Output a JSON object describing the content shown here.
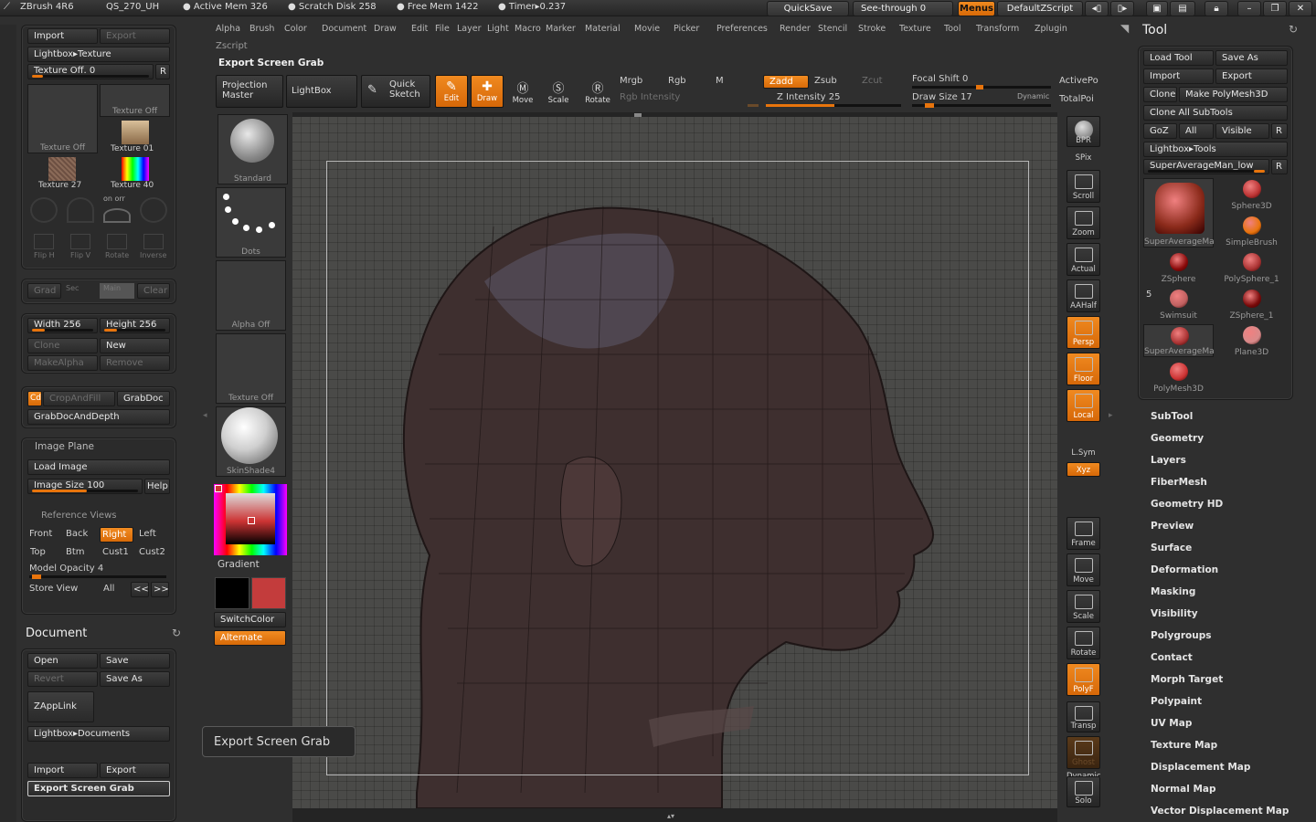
{
  "topbar": {
    "app": "ZBrush 4R6",
    "file": "QS_270_UH",
    "active_mem": "● Active Mem 326",
    "scratch": "● Scratch Disk 258",
    "free_mem": "● Free Mem 1422",
    "timer": "● Timer▸0.237",
    "quicksave": "QuickSave",
    "see_through": "See-through   0",
    "menus": "Menus",
    "script": "DefaultZScript"
  },
  "menubar": [
    "Alpha",
    "Brush",
    "Color",
    "Document",
    "Draw",
    "Edit",
    "File",
    "Layer",
    "Light",
    "Macro",
    "Marker",
    "Material",
    "Movie",
    "Picker",
    "Preferences",
    "Render",
    "Stencil",
    "Stroke",
    "Texture",
    "Tool",
    "Transform",
    "Zplugin"
  ],
  "menubar2": "Zscript",
  "shelf": {
    "title": "Export Screen Grab",
    "projection_master": "Projection Master",
    "lightbox": "LightBox",
    "quick_sketch": "Quick Sketch",
    "edit": "Edit",
    "draw": "Draw",
    "move": "Move",
    "scale": "Scale",
    "rotate": "Rotate",
    "mrgb": "Mrgb",
    "rgb": "Rgb",
    "m": "M",
    "rgb_intensity": "Rgb  Intensity",
    "zadd": "Zadd",
    "zsub": "Zsub",
    "zcut": "Zcut",
    "z_intensity": "Z  Intensity 25",
    "focal_shift": "Focal  Shift 0",
    "draw_size": "Draw  Size 17",
    "dynamic": "Dynamic",
    "active_points": "ActivePo",
    "total_points": "TotalPoi"
  },
  "left": {
    "import": "Import",
    "export": "Export",
    "lightbox_texture": "Lightbox▸Texture",
    "texture_off": "Texture  Off. 0",
    "r": "R",
    "tex_thumbs": [
      "Texture  Off",
      "Texture  Off",
      "Texture  01",
      "Texture  27",
      "Texture  40"
    ],
    "onoff": "on  orr",
    "fliph": "Flip H",
    "flipv": "Flip V",
    "rotate": "Rotate",
    "inverse": "Inverse",
    "grad": "Grad",
    "sec": "Sec",
    "main": "Main",
    "clear": "Clear",
    "width": "Width 256",
    "height": "Height 256",
    "clone": "Clone",
    "new": "New",
    "make_alpha": "MakeAlpha",
    "remove": "Remove",
    "cd": "Cd",
    "crop_and_fill": "CropAndFill",
    "grab_doc": "GrabDoc",
    "grab_doc_depth": "GrabDocAndDepth",
    "image_plane": "Image  Plane",
    "load_image": "Load  Image",
    "image_size": "Image  Size 100",
    "help": "Help",
    "reference_views": "Reference  Views",
    "front": "Front",
    "back": "Back",
    "right": "Right",
    "left_btn": "Left",
    "top": "Top",
    "btm": "Btm",
    "cust1": "Cust1",
    "cust2": "Cust2",
    "model_opacity": "Model  Opacity 4",
    "store_view": "Store  View",
    "all": "All",
    "prev": "<<",
    "next": ">>",
    "document": "Document",
    "open": "Open",
    "save": "Save",
    "revert": "Revert",
    "save_as": "Save  As",
    "zapplink": "ZAppLink",
    "lightbox_documents": "Lightbox▸Documents",
    "doc_import": "Import",
    "doc_export": "Export",
    "export_screen_grab": "Export  Screen  Grab"
  },
  "brushcol": {
    "standard": "Standard",
    "dots": "Dots",
    "alpha_off": "Alpha  Off",
    "texture_off": "Texture  Off",
    "skinshade": "SkinShade4",
    "gradient": "Gradient",
    "switch_color": "SwitchColor",
    "alternate": "Alternate"
  },
  "tooltip": "Export Screen Grab",
  "rightbar": [
    "BPR",
    "SPix",
    "Scroll",
    "Zoom",
    "Actual",
    "AAHalf",
    "Persp",
    "Floor",
    "Local",
    "L.Sym",
    "Xyz",
    "Frame",
    "Move",
    "Scale",
    "Rotate",
    "PolyF",
    "Transp",
    "Ghost",
    "Dynamic",
    "Solo"
  ],
  "tool": {
    "title": "Tool",
    "load_tool": "Load  Tool",
    "save_as": "Save  As",
    "import": "Import",
    "export": "Export",
    "clone": "Clone",
    "make_polymesh": "Make  PolyMesh3D",
    "clone_all": "Clone  All  SubTools",
    "goz": "GoZ",
    "all": "All",
    "visible": "Visible",
    "r": "R",
    "lightbox_tools": "Lightbox▸Tools",
    "current": "SuperAverageMan_low",
    "count": "5",
    "items": [
      "SuperAverageMa",
      "Sphere3D",
      "SimpleBrush",
      "ZSphere",
      "PolySphere_1",
      "Swimsuit",
      "ZSphere_1",
      "SuperAverageMa",
      "Plane3D",
      "PolyMesh3D"
    ],
    "sections": [
      "SubTool",
      "Geometry",
      "Layers",
      "FiberMesh",
      "Geometry HD",
      "Preview",
      "Surface",
      "Deformation",
      "Masking",
      "Visibility",
      "Polygroups",
      "Contact",
      "Morph Target",
      "Polypaint",
      "UV Map",
      "Texture Map",
      "Displacement Map",
      "Normal Map",
      "Vector Displacement Map"
    ]
  }
}
